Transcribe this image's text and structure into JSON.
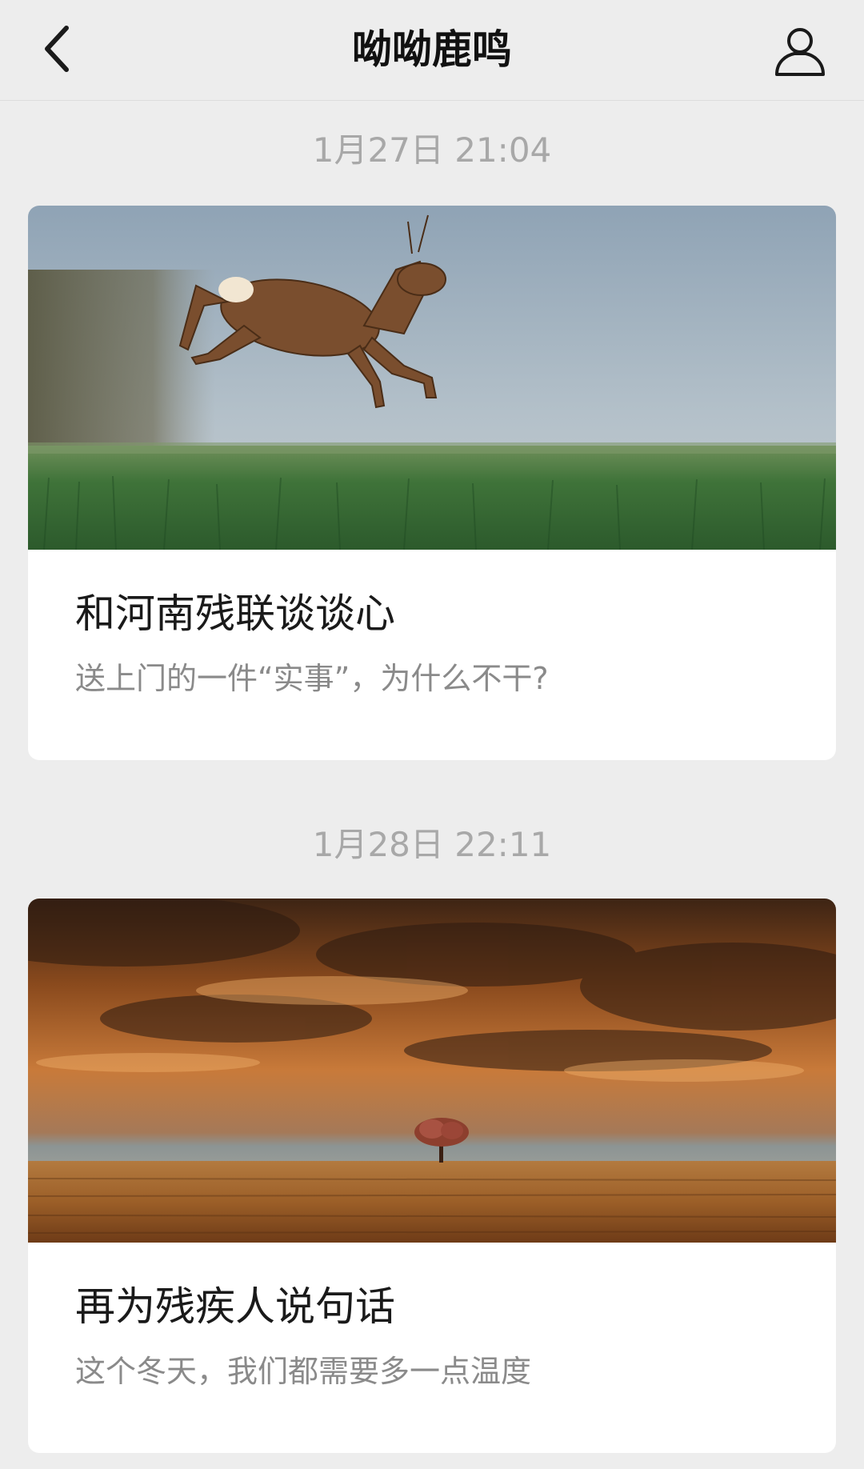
{
  "navbar": {
    "title": "呦呦鹿鸣",
    "back_icon": "chevron-left-icon",
    "profile_icon": "person-icon"
  },
  "feed": [
    {
      "timestamp": "1月27日 21:04",
      "image": "leaping-deer-over-green-field",
      "title": "和河南残联谈谈心",
      "subtitle": "送上门的一件“实事”，为什么不干?"
    },
    {
      "timestamp": "1月28日 22:11",
      "image": "lone-tree-in-golden-field-under-stormy-sky",
      "title": "再为残疾人说句话",
      "subtitle": "这个冬天，我们都需要多一点温度"
    }
  ],
  "colors": {
    "background": "#ededed",
    "card": "#ffffff",
    "timestamp": "#a8a8a8",
    "subtitle": "#8a8a8a"
  }
}
